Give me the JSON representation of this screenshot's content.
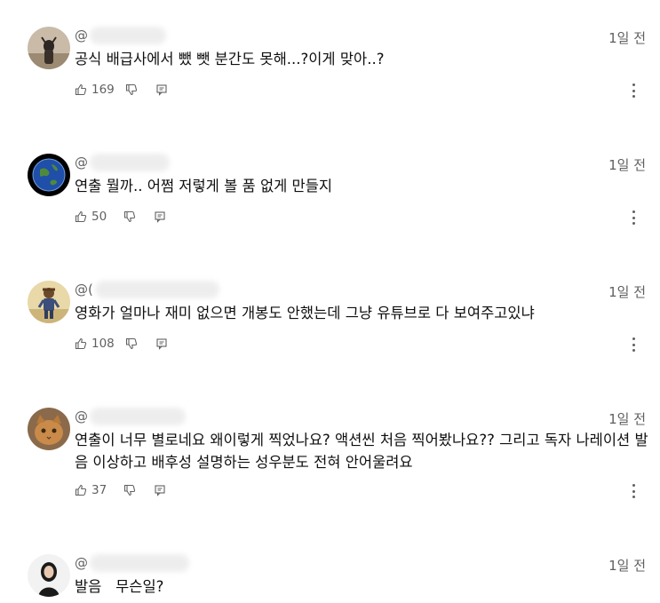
{
  "comments": [
    {
      "handle_prefix": "@",
      "time": "1일 전",
      "text": "공식 배급사에서 뺐 뺏 분간도 못해...?이게 맞아..?",
      "likes": "169"
    },
    {
      "handle_prefix": "@",
      "time": "1일 전",
      "text": "연출 뭘까.. 어쩜 저렇게 볼 품 없게 만들지",
      "likes": "50"
    },
    {
      "handle_prefix": "@(",
      "time": "1일 전",
      "text": "영화가 얼마나 재미 없으면 개봉도 안했는데 그냥 유튜브로 다 보여주고있냐",
      "likes": "108"
    },
    {
      "handle_prefix": "@",
      "time": "1일 전",
      "text": "연출이 너무 별로네요 왜이렇게 찍었나요? 액션씬 처음 찍어봤나요?? 그리고 독자 나레이션 발\n음 이상하고 배후성 설명하는 성우분도 전혀 안어울려요",
      "likes": "37"
    },
    {
      "handle_prefix": "@",
      "time": "1일 전",
      "text": "발음   무슨일?",
      "likes": ""
    }
  ],
  "icons": {
    "like": "thumbs-up-icon",
    "dislike": "thumbs-down-icon",
    "reply": "reply-icon",
    "more": "more-vertical-icon"
  },
  "colors": {
    "text": "#0f0f0f",
    "meta": "#606060"
  }
}
